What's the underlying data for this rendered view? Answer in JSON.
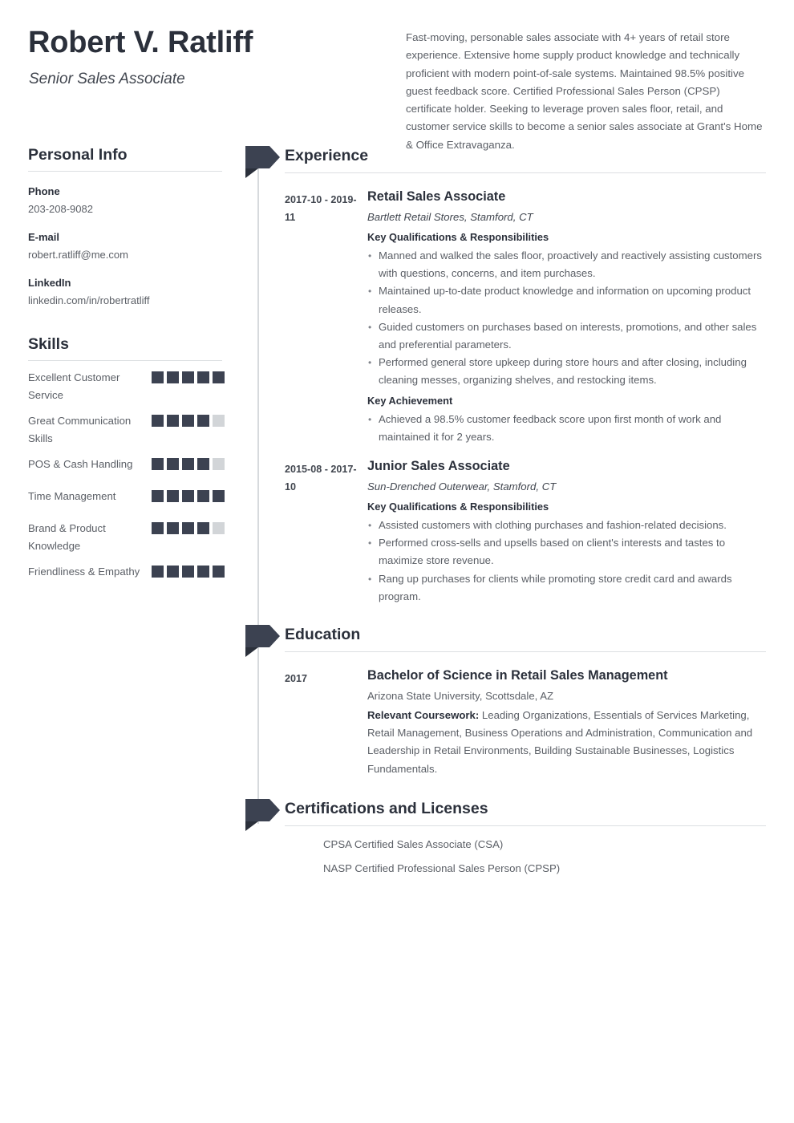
{
  "header": {
    "name": "Robert V. Ratliff",
    "job_title": "Senior Sales Associate",
    "summary": "Fast-moving, personable sales associate with 4+ years of retail store experience. Extensive home supply product knowledge and technically proficient with modern point-of-sale systems. Maintained 98.5% positive guest feedback score. Certified Professional Sales Person (CPSP) certificate holder. Seeking to leverage proven sales floor, retail, and customer service skills to become a senior sales associate at Grant's Home & Office Extravaganza."
  },
  "colors": {
    "accent_dark": "#3c4251",
    "heading": "#2b303b",
    "body_text": "#5b5f66",
    "rule": "#dcdfe2",
    "dot_empty": "#d2d5d8"
  },
  "sidebar": {
    "personal_info": {
      "title": "Personal Info",
      "fields": [
        {
          "label": "Phone",
          "value": "203-208-9082"
        },
        {
          "label": "E-mail",
          "value": "robert.ratliff@me.com"
        },
        {
          "label": "LinkedIn",
          "value": "linkedin.com/in/robertratliff"
        }
      ]
    },
    "skills": {
      "title": "Skills",
      "max_rating": 5,
      "items": [
        {
          "name": "Excellent Customer Service",
          "rating": 5
        },
        {
          "name": "Great Communication Skills",
          "rating": 4
        },
        {
          "name": "POS & Cash Handling",
          "rating": 4
        },
        {
          "name": "Time Management",
          "rating": 5
        },
        {
          "name": "Brand & Product Knowledge",
          "rating": 4
        },
        {
          "name": "Friendliness & Empathy",
          "rating": 5
        }
      ]
    }
  },
  "main": {
    "experience": {
      "title": "Experience",
      "entries": [
        {
          "date": "2017-10 - 2019-11",
          "title": "Retail Sales Associate",
          "subtitle": "Bartlett Retail Stores, Stamford, CT",
          "groups": [
            {
              "heading": "Key Qualifications & Responsibilities",
              "bullets": [
                "Manned and walked the sales floor, proactively and reactively assisting customers with questions, concerns, and item purchases.",
                "Maintained up-to-date product knowledge and information on upcoming product releases.",
                "Guided customers on purchases based on interests, promotions, and other sales and preferential parameters.",
                "Performed general store upkeep during store hours and after closing, including cleaning messes, organizing shelves, and restocking items."
              ]
            },
            {
              "heading": "Key Achievement",
              "bullets": [
                "Achieved a 98.5% customer feedback score upon first month of work and maintained it for 2 years."
              ]
            }
          ]
        },
        {
          "date": "2015-08 - 2017-10",
          "title": "Junior Sales Associate",
          "subtitle": "Sun-Drenched Outerwear, Stamford, CT",
          "groups": [
            {
              "heading": "Key Qualifications & Responsibilities",
              "bullets": [
                "Assisted customers with clothing purchases and fashion-related decisions.",
                "Performed cross-sells and upsells based on client's interests and tastes to maximize store revenue.",
                "Rang up purchases for clients while promoting store credit card and awards program."
              ]
            }
          ]
        }
      ]
    },
    "education": {
      "title": "Education",
      "entries": [
        {
          "date": "2017",
          "title": "Bachelor of Science in Retail Sales Management",
          "subtitle": "Arizona State University, Scottsdale, AZ",
          "coursework_label": "Relevant Coursework:",
          "coursework": " Leading Organizations, Essentials of Services Marketing, Retail Management, Business Operations and Administration, Communication and Leadership in Retail Environments, Building Sustainable Businesses, Logistics Fundamentals."
        }
      ]
    },
    "certifications": {
      "title": "Certifications and Licenses",
      "items": [
        "CPSA Certified Sales Associate (CSA)",
        "NASP Certified Professional Sales Person (CPSP)"
      ]
    }
  }
}
